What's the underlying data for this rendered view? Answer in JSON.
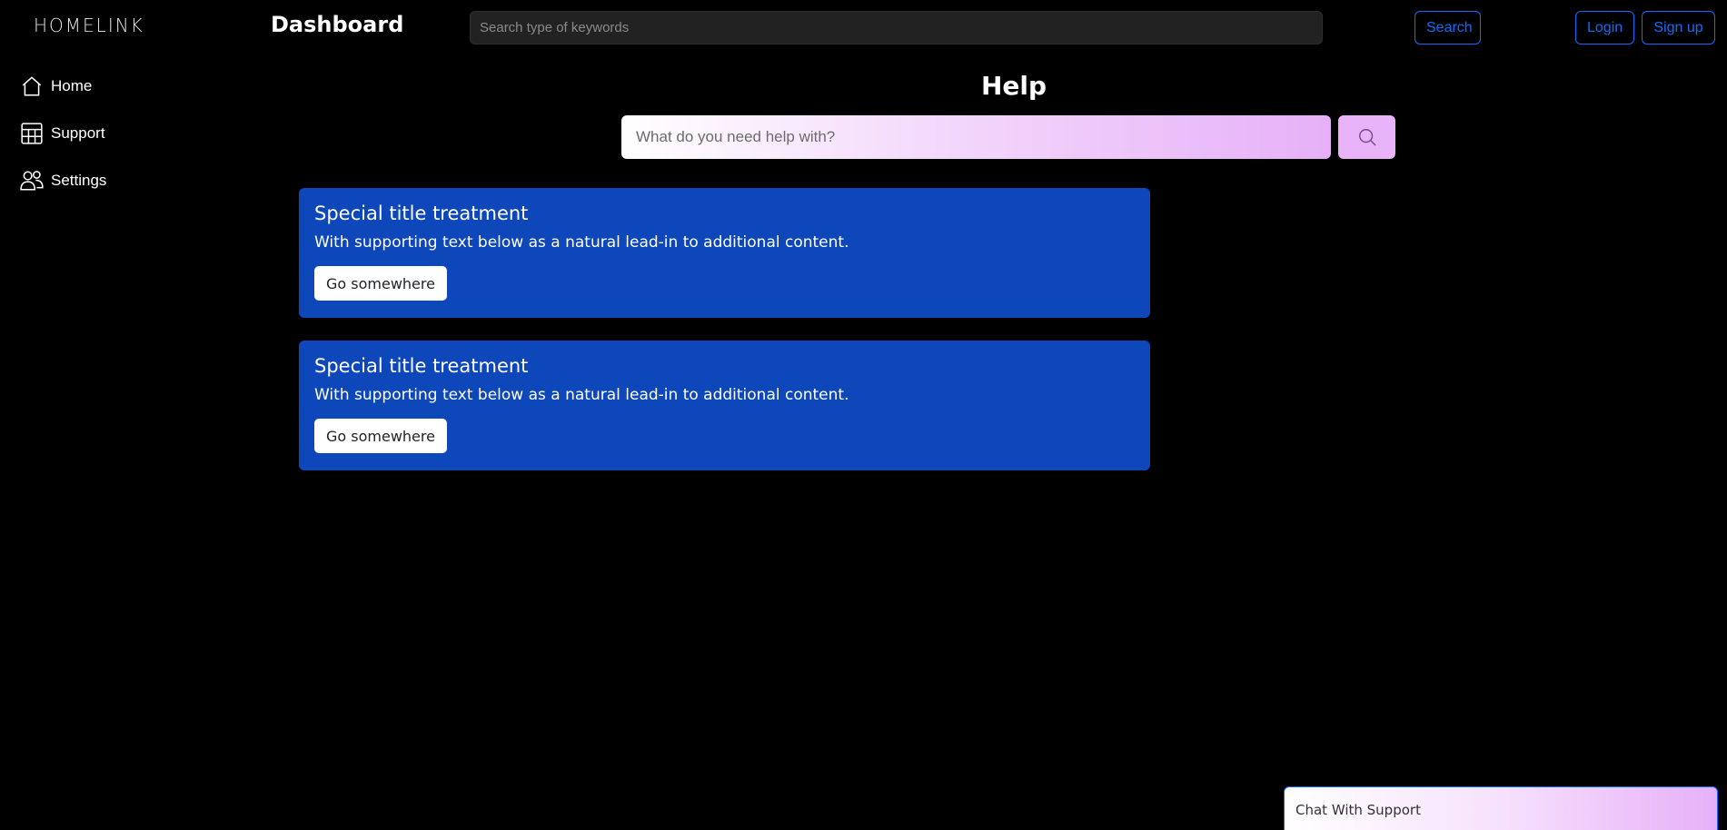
{
  "header": {
    "logo": "HOMELINK",
    "title": "Dashboard",
    "search_placeholder": "Search type of keywords",
    "search_button": "Search",
    "login_button": "Login",
    "signup_button": "Sign up",
    "accent_color": "#0d6efd"
  },
  "sidebar": {
    "items": [
      {
        "label": "Home",
        "icon": "house-icon"
      },
      {
        "label": "Support",
        "icon": "table-icon"
      },
      {
        "label": "Settings",
        "icon": "people-icon"
      }
    ]
  },
  "help": {
    "title": "Help",
    "input_placeholder": "What do you need help with?",
    "search_icon": "search-icon"
  },
  "cards": [
    {
      "title": "Special title treatment",
      "text": "With supporting text below as a natural lead-in to additional content.",
      "button": "Go somewhere",
      "color": "#0d47b9"
    },
    {
      "title": "Special title treatment",
      "text": "With supporting text below as a natural lead-in to additional content.",
      "button": "Go somewhere",
      "color": "#0d47b9"
    }
  ],
  "chat": {
    "label": "Chat With Support"
  }
}
